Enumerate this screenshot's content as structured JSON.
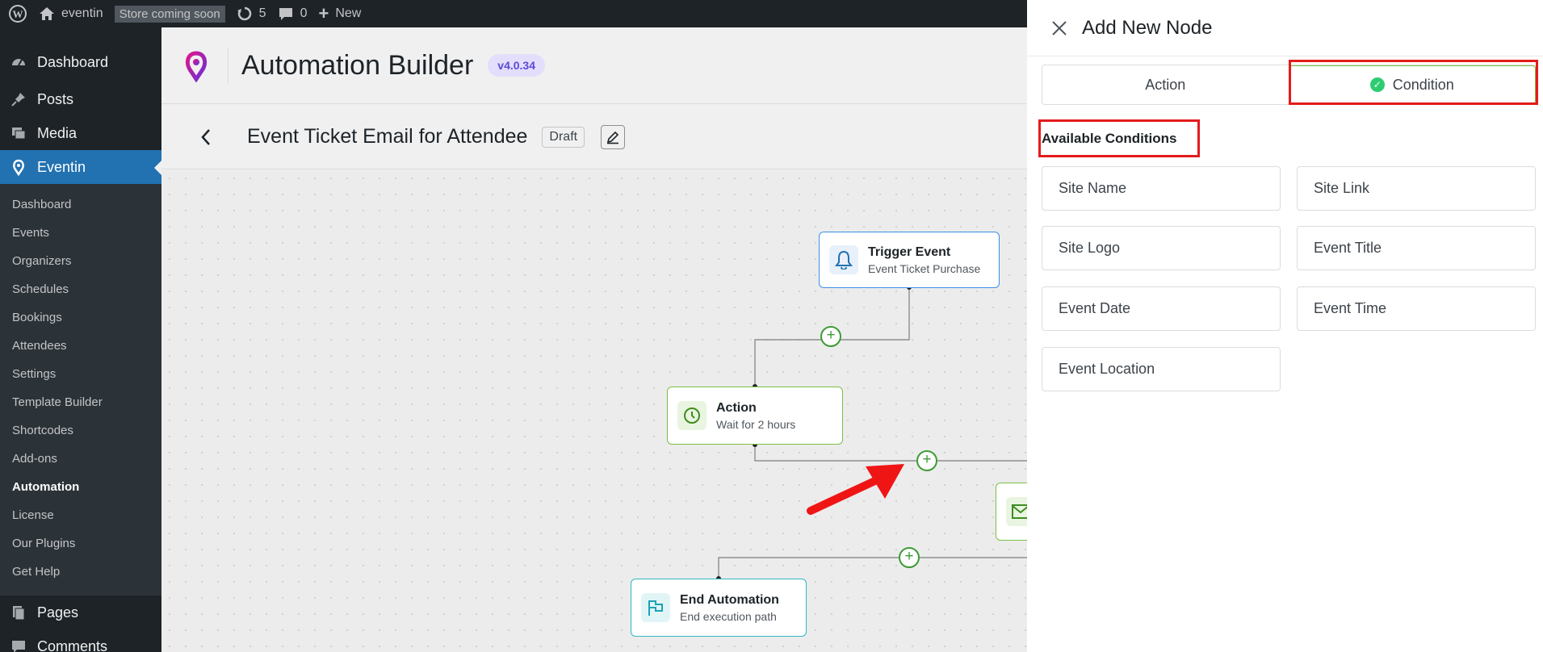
{
  "adminbar": {
    "site_name": "eventin",
    "store_badge": "Store coming soon",
    "updates_count": "5",
    "comments_count": "0",
    "new_label": "New"
  },
  "sidebar": {
    "top_items": [
      {
        "label": "Dashboard"
      },
      {
        "label": "Posts"
      },
      {
        "label": "Media"
      },
      {
        "label": "Eventin"
      }
    ],
    "submenu": [
      {
        "label": "Dashboard"
      },
      {
        "label": "Events"
      },
      {
        "label": "Organizers"
      },
      {
        "label": "Schedules"
      },
      {
        "label": "Bookings"
      },
      {
        "label": "Attendees"
      },
      {
        "label": "Settings"
      },
      {
        "label": "Template Builder"
      },
      {
        "label": "Shortcodes"
      },
      {
        "label": "Add-ons"
      },
      {
        "label": "Automation"
      },
      {
        "label": "License"
      },
      {
        "label": "Our Plugins"
      },
      {
        "label": "Get Help"
      }
    ],
    "bottom_items": [
      {
        "label": "Pages"
      },
      {
        "label": "Comments"
      }
    ]
  },
  "header": {
    "title": "Automation Builder",
    "version": "v4.0.34"
  },
  "workflow": {
    "title": "Event Ticket Email for Attendee",
    "status": "Draft"
  },
  "nodes": {
    "trigger": {
      "title": "Trigger Event",
      "subtitle": "Event Ticket Purchase"
    },
    "action": {
      "title": "Action",
      "subtitle": "Wait for 2 hours"
    },
    "end": {
      "title": "End Automation",
      "subtitle": "End execution path"
    }
  },
  "panel": {
    "title": "Add New Node",
    "tabs": [
      {
        "label": "Action"
      },
      {
        "label": "Condition"
      }
    ],
    "section_title": "Available Conditions",
    "conditions": [
      {
        "label": "Site Name"
      },
      {
        "label": "Site Link"
      },
      {
        "label": "Site Logo"
      },
      {
        "label": "Event Title"
      },
      {
        "label": "Event Date"
      },
      {
        "label": "Event Time"
      },
      {
        "label": "Event Location"
      }
    ]
  },
  "colors": {
    "admin_dark": "#1d2327",
    "active_blue": "#2271b1",
    "highlight_red": "#e41b1b",
    "add_green": "#3d9b35"
  }
}
